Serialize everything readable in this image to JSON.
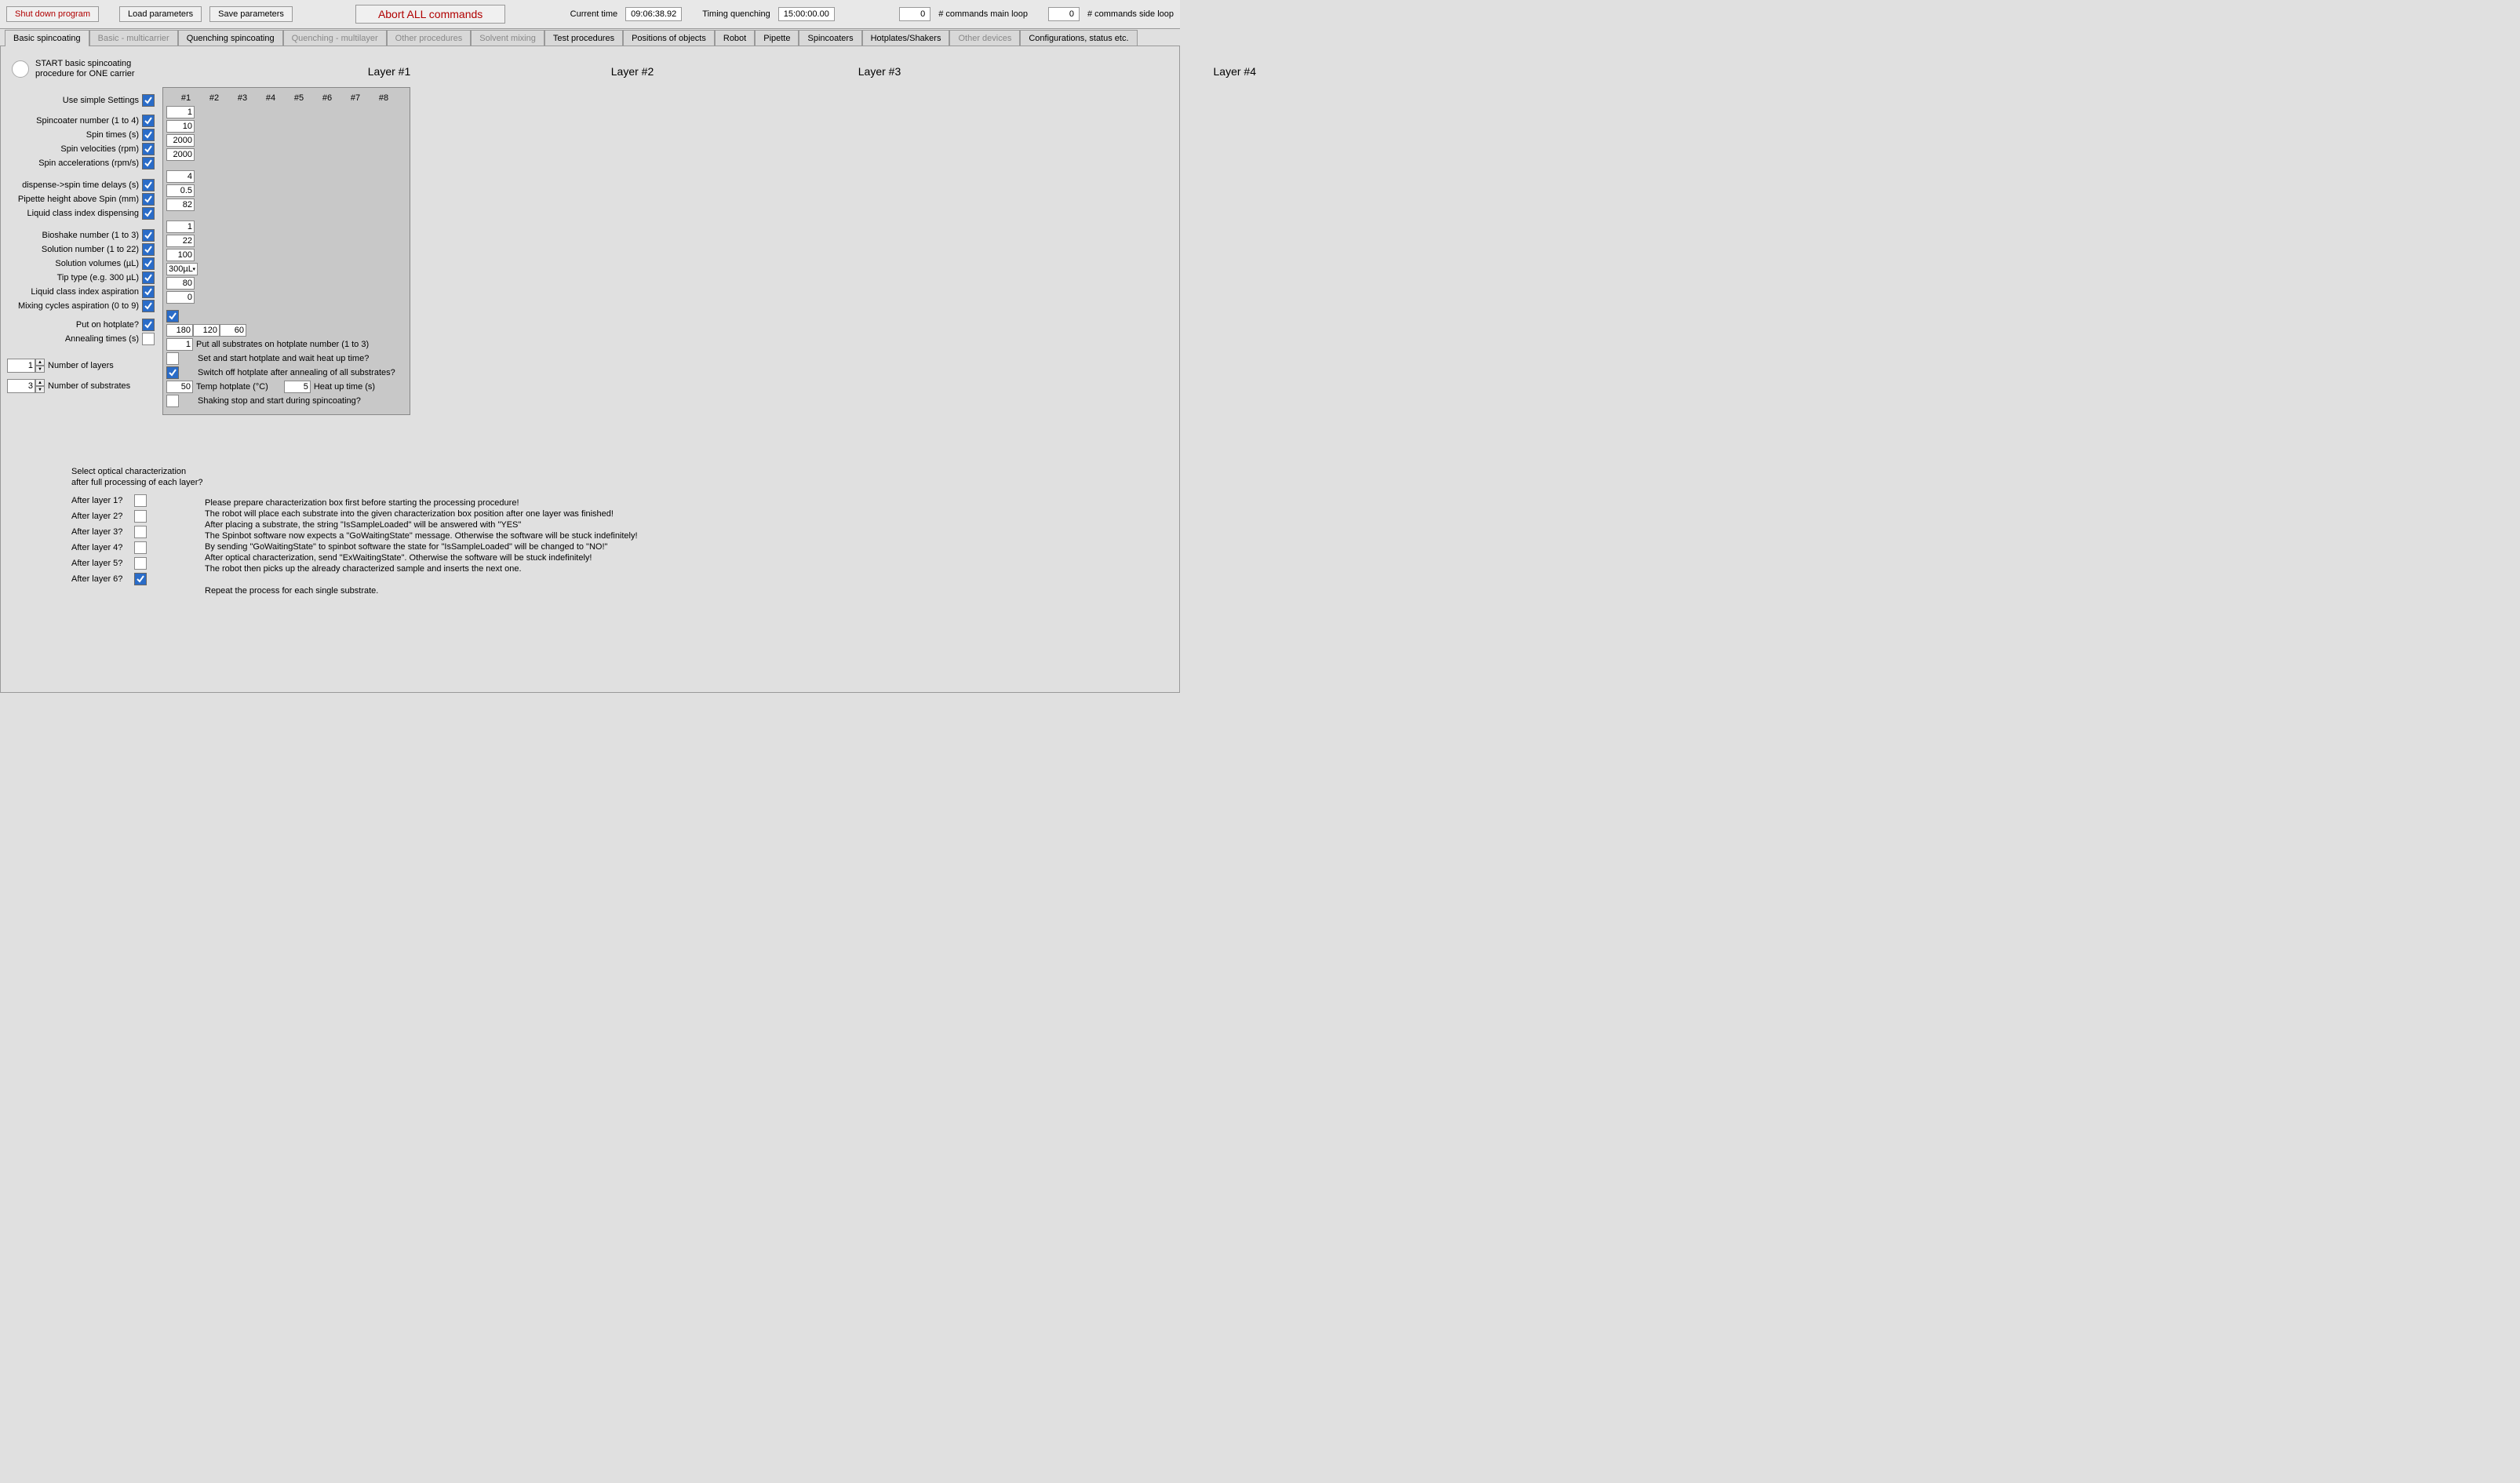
{
  "toolbar": {
    "shutdown": "Shut down program",
    "load_params": "Load parameters",
    "save_params": "Save parameters",
    "abort": "Abort ALL commands",
    "current_time_label": "Current time",
    "current_time_value": "09:06:38.92",
    "timing_quench_label": "Timing quenching",
    "timing_quench_value": "15:00:00.00",
    "cmds_main_value": "0",
    "cmds_main_label": "# commands main loop",
    "cmds_side_value": "0",
    "cmds_side_label": "# commands side loop"
  },
  "tabs": [
    {
      "label": "Basic spincoating",
      "state": "active"
    },
    {
      "label": "Basic - multicarrier",
      "state": "disabled"
    },
    {
      "label": "Quenching spincoating",
      "state": "normal"
    },
    {
      "label": "Quenching - multilayer",
      "state": "disabled"
    },
    {
      "label": "Other procedures",
      "state": "disabled"
    },
    {
      "label": "Solvent mixing",
      "state": "disabled"
    },
    {
      "label": "Test procedures",
      "state": "normal"
    },
    {
      "label": "Positions of objects",
      "state": "normal"
    },
    {
      "label": "Robot",
      "state": "normal"
    },
    {
      "label": "Pipette",
      "state": "normal"
    },
    {
      "label": "Spincoaters",
      "state": "normal"
    },
    {
      "label": "Hotplates/Shakers",
      "state": "normal"
    },
    {
      "label": "Other devices",
      "state": "disabled"
    },
    {
      "label": "Configurations, status etc.",
      "state": "normal"
    }
  ],
  "start": {
    "line1": "START basic spincoating",
    "line2": "procedure for ONE carrier"
  },
  "layer_headers": [
    "Layer #1",
    "Layer #2",
    "Layer #3",
    "Layer #4"
  ],
  "col_headers": [
    "#1",
    "#2",
    "#3",
    "#4",
    "#5",
    "#6",
    "#7",
    "#8"
  ],
  "params": {
    "simple": {
      "label": "Use simple Settings",
      "checked": true
    },
    "rows": [
      {
        "label": "Spincoater number (1 to 4)",
        "checked": true,
        "value": "1"
      },
      {
        "label": "Spin times (s)",
        "checked": true,
        "value": "10"
      },
      {
        "label": "Spin velocities (rpm)",
        "checked": true,
        "value": "2000"
      },
      {
        "label": "Spin accelerations (rpm/s)",
        "checked": true,
        "value": "2000"
      }
    ],
    "rows2": [
      {
        "label": "dispense->spin time delays (s)",
        "checked": true,
        "value": "4"
      },
      {
        "label": "Pipette height above Spin (mm)",
        "checked": true,
        "value": "0.5"
      },
      {
        "label": "Liquid class index dispensing",
        "checked": true,
        "value": "82"
      }
    ],
    "rows3": [
      {
        "label": "Bioshake number (1 to 3)",
        "checked": true,
        "value": "1"
      },
      {
        "label": "Solution number (1 to 22)",
        "checked": true,
        "value": "22"
      },
      {
        "label": "Solution volumes (µL)",
        "checked": true,
        "value": "100"
      },
      {
        "label": "Tip type (e.g. 300 µL)",
        "checked": true,
        "value": "300µL",
        "dropdown": true
      },
      {
        "label": "Liquid class index aspiration",
        "checked": true,
        "value": "80"
      },
      {
        "label": "Mixing cycles aspiration (0 to 9)",
        "checked": true,
        "value": "0"
      }
    ],
    "hotplate_label": "Put on hotplate?",
    "hotplate_checked": true,
    "anneal_label": "Annealing times (s)",
    "anneal_vals": [
      "180",
      "120",
      "60"
    ],
    "hotplate_num_value": "1",
    "hotplate_num_label": "Put all substrates on hotplate number (1 to 3)",
    "set_start_label": "Set and start hotplate and wait heat up time?",
    "switch_off_label": "Switch off hotplate after annealing of all substrates?",
    "temp_value": "50",
    "temp_label": "Temp hotplate (°C)",
    "heatup_value": "5",
    "heatup_label": "Heat up time (s)",
    "shaking_label": "Shaking stop and start during spincoating?"
  },
  "nlayers": {
    "nlayers_value": "1",
    "nlayers_label": "Number of layers",
    "nsubs_value": "3",
    "nsubs_label": "Number of substrates"
  },
  "optical": {
    "title1": "Select optical characterization",
    "title2": "after full processing of each layer?",
    "rows": [
      {
        "label": "After layer 1?",
        "checked": false
      },
      {
        "label": "After layer 2?",
        "checked": false
      },
      {
        "label": "After layer 3?",
        "checked": false
      },
      {
        "label": "After layer 4?",
        "checked": false
      },
      {
        "label": "After layer 5?",
        "checked": false
      },
      {
        "label": "After layer 6?",
        "checked": true
      }
    ],
    "instructions": [
      "Please prepare characterization box first before starting the processing procedure!",
      "The robot will place each substrate into the given characterization box position after one layer was finished!",
      "After placing a substrate, the string \"IsSampleLoaded\" will be answered with \"YES\"",
      "The Spinbot software now expects a \"GoWaitingState\" message. Otherwise the software will be stuck indefinitely!",
      "By sending \"GoWaitingState\" to spinbot software the state for \"IsSampleLoaded\" will be changed to \"NO!\"",
      "After optical characterization, send \"ExWaitingState\". Otherwise the software will be stuck indefinitely!",
      "The robot then picks up the already characterized sample and inserts the next one.",
      "",
      "Repeat the process for each single substrate."
    ]
  }
}
